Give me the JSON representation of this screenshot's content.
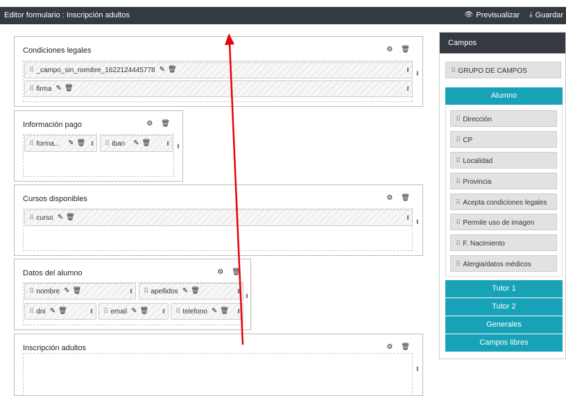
{
  "header": {
    "title": "Editor formulario : Inscripción adultos",
    "preview_label": "Previsualizar",
    "save_label": "Guardar"
  },
  "sections": [
    {
      "title": "Condiciones legales",
      "fields": [
        "_campo_sin_nombre_1622124445778",
        "firma"
      ]
    },
    {
      "title": "Información pago",
      "fields": [
        "forma...",
        "iban"
      ]
    },
    {
      "title": "Cursos disponibles",
      "fields": [
        "curso"
      ]
    },
    {
      "title": "Datos del alumno",
      "fields": [
        "nombre",
        "apellidos",
        "dni",
        "email",
        "telefono"
      ]
    },
    {
      "title": "Inscripción adultos",
      "fields": []
    }
  ],
  "sidebar": {
    "title": "Campos",
    "group_label": "GRUPO DE CAMPOS",
    "groups": [
      {
        "label": "Alumno",
        "items": [
          "Dirección",
          "CP",
          "Localidad",
          "Provincia",
          "Acepta condiciones legales",
          "Permite uso de imagen",
          "F. Nacimiento",
          "Alergia/datos médicos"
        ]
      },
      {
        "label": "Tutor 1"
      },
      {
        "label": "Tutor 2"
      },
      {
        "label": "Generales"
      },
      {
        "label": "Campos libres"
      }
    ]
  },
  "colors": {
    "topbar": "#343a40",
    "accent": "#17a2b8",
    "annotation": "#e8000b"
  }
}
